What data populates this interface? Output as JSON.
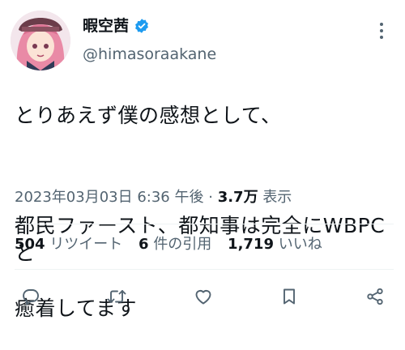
{
  "author": {
    "display_name": "暇空茜",
    "handle": "@himasoraakane",
    "verified_icon": "verified-badge-icon",
    "verified_color": "#1d9bf0"
  },
  "tweet": {
    "text_lines": [
      "とりあえず僕の感想として、",
      "",
      "都民ファースト、都知事は完全にWBPCと",
      "癒着してます"
    ]
  },
  "meta": {
    "timestamp": "2023年03月03日 6:36 午後",
    "separator": "·",
    "views_count": "3.7万",
    "views_label": "表示"
  },
  "stats": {
    "retweets_count": "504",
    "retweets_label": "リツイート",
    "quotes_count": "6",
    "quotes_label": "件の引用",
    "likes_count": "1,719",
    "likes_label": "いいね"
  },
  "actions": {
    "reply_icon": "reply-icon",
    "retweet_icon": "retweet-icon",
    "like_icon": "heart-icon",
    "bookmark_icon": "bookmark-icon",
    "share_icon": "share-icon",
    "icon_color": "#536471"
  }
}
